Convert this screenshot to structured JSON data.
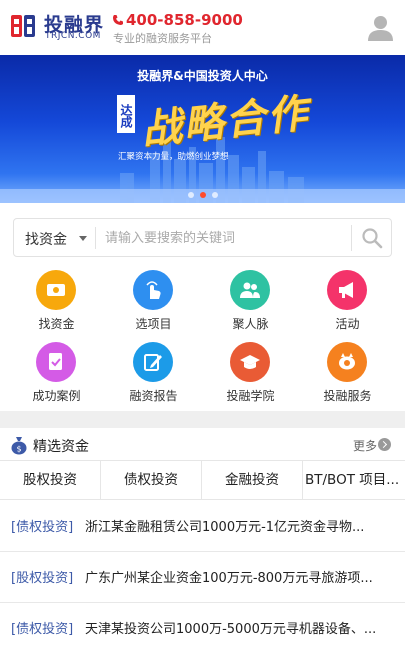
{
  "header": {
    "brand": "投融界",
    "brand_sub": "TRJCN.COM",
    "phone": "400-858-9000",
    "slogan": "专业的融资服务平台",
    "icons": {
      "logo": "trjcn-logo-icon",
      "phone": "phone-icon",
      "user": "user-icon"
    },
    "colors": {
      "brand": "#2a3b8f",
      "phone": "#e0262e"
    }
  },
  "banner": {
    "title": "投融界&中国投资人中心",
    "badge": "达成",
    "main": "战略合作",
    "sub": "汇聚资本力量，助燃创业梦想",
    "slides": 3,
    "active_slide": 2
  },
  "search": {
    "type": "找资金",
    "placeholder": "请输入要搜索的关键词",
    "icon": "search-icon"
  },
  "grid": [
    {
      "label": "找资金",
      "icon": "money-icon",
      "color": "#f7a80c"
    },
    {
      "label": "选项目",
      "icon": "hand-pointer-icon",
      "color": "#2e8ff0"
    },
    {
      "label": "聚人脉",
      "icon": "people-icon",
      "color": "#2ec2a2"
    },
    {
      "label": "活动",
      "icon": "megaphone-icon",
      "color": "#f4336a"
    },
    {
      "label": "成功案例",
      "icon": "document-check-icon",
      "color": "#d45be6"
    },
    {
      "label": "融资报告",
      "icon": "report-edit-icon",
      "color": "#1c9be8"
    },
    {
      "label": "投融学院",
      "icon": "graduation-cap-icon",
      "color": "#e95b35"
    },
    {
      "label": "投融服务",
      "icon": "piggy-bank-icon",
      "color": "#f5811f"
    }
  ],
  "featured": {
    "title": "精选资金",
    "more": "更多",
    "icon": "money-bag-icon",
    "tabs": [
      "股权投资",
      "债权投资",
      "金融投资",
      "BT/BOT 项目..."
    ],
    "items": [
      {
        "tag": "[债权投资]",
        "text": "浙江某金融租赁公司1000万元-1亿元资金寻物..."
      },
      {
        "tag": "[股权投资]",
        "text": "广东广州某企业资金100万元-800万元寻旅游项..."
      },
      {
        "tag": "[债权投资]",
        "text": "天津某投资公司1000万-5000万元寻机器设备、..."
      }
    ]
  }
}
